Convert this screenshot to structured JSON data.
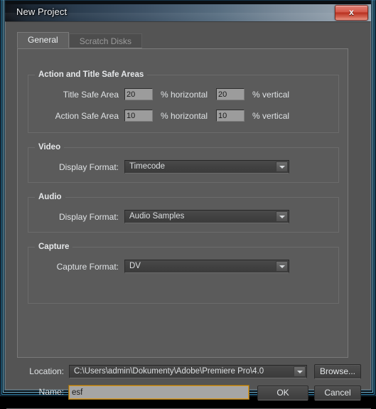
{
  "window": {
    "title": "New Project",
    "close_icon": "close-icon",
    "close_label": "x"
  },
  "tabs": [
    {
      "label": "General",
      "active": true
    },
    {
      "label": "Scratch Disks",
      "active": false
    }
  ],
  "groups": {
    "safe_areas": {
      "title": "Action and Title Safe Areas",
      "rows": [
        {
          "label": "Title Safe Area",
          "horizontal_value": "20",
          "horizontal_unit": "% horizontal",
          "vertical_value": "20",
          "vertical_unit": "% vertical"
        },
        {
          "label": "Action Safe Area",
          "horizontal_value": "10",
          "horizontal_unit": "% horizontal",
          "vertical_value": "10",
          "vertical_unit": "% vertical"
        }
      ]
    },
    "video": {
      "title": "Video",
      "field_label": "Display Format:",
      "value": "Timecode",
      "arrow_icon": "chevron-down-icon"
    },
    "audio": {
      "title": "Audio",
      "field_label": "Display Format:",
      "value": "Audio Samples",
      "arrow_icon": "chevron-down-icon"
    },
    "capture": {
      "title": "Capture",
      "field_label": "Capture Format:",
      "value": "DV",
      "arrow_icon": "chevron-down-icon"
    }
  },
  "footer": {
    "location_label": "Location:",
    "location_value": "C:\\Users\\admin\\Dokumenty\\Adobe\\Premiere Pro\\4.0",
    "location_arrow_icon": "chevron-down-icon",
    "browse_label": "Browse...",
    "name_label": "Name:",
    "name_value": "esf",
    "name_placeholder": "",
    "ok_label": "OK",
    "cancel_label": "Cancel"
  },
  "colors": {
    "dialog_bg": "#545454",
    "panel_bg": "#5b5b5b",
    "focus_border": "#d79a2b",
    "close_red": "#b8301f",
    "glow_blue": "#6fb7d6"
  }
}
